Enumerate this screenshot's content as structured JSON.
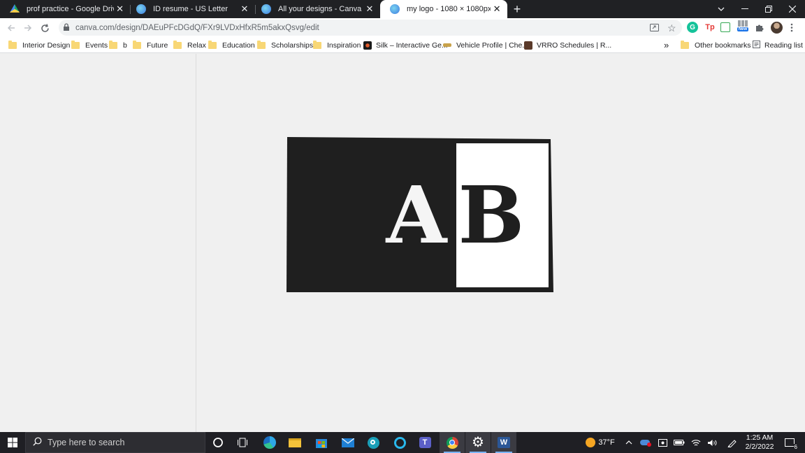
{
  "tabs": [
    {
      "title": "prof practice - Google Drive",
      "icon": "google-drive-icon"
    },
    {
      "title": "ID resume - US Letter",
      "icon": "canva-icon"
    },
    {
      "title": "All your designs - Canva",
      "icon": "canva-icon"
    },
    {
      "title": "my logo - 1080 × 1080px",
      "icon": "canva-icon",
      "active": true
    }
  ],
  "new_tab_label": "+",
  "address_bar": {
    "url": "canva.com/design/DAEuPFcDGdQ/FXr9LVDxHfxR5m5akxQsvg/edit"
  },
  "extensions": {
    "tp_label": "Tp",
    "new_badge": "New"
  },
  "bookmarks": [
    {
      "label": "Interior Design",
      "type": "folder"
    },
    {
      "label": "Events",
      "type": "folder"
    },
    {
      "label": "b",
      "type": "folder"
    },
    {
      "label": "Future",
      "type": "folder"
    },
    {
      "label": "Relax",
      "type": "folder"
    },
    {
      "label": "Education",
      "type": "folder"
    },
    {
      "label": "Scholarships",
      "type": "folder"
    },
    {
      "label": "Inspiration",
      "type": "folder"
    },
    {
      "label": "Silk – Interactive Ge...",
      "type": "link"
    },
    {
      "label": "Vehicle Profile | Che...",
      "type": "link"
    },
    {
      "label": "VRRO Schedules | R...",
      "type": "link"
    }
  ],
  "bookmarks_overflow": "»",
  "other_bookmarks": "Other bookmarks",
  "reading_list": "Reading list",
  "design": {
    "letter_left": "A",
    "letter_right": "B",
    "dark_color": "#1f1f1f",
    "light_color": "#ffffff"
  },
  "taskbar": {
    "search_placeholder": "Type here to search",
    "weather": "37°F",
    "time": "1:25 AM",
    "date": "2/2/2022",
    "notification_count": "6"
  },
  "colors": {
    "tab_strip": "#202124",
    "canvas_bg": "#f0f0f0",
    "taskbar": "#1f1f24"
  }
}
